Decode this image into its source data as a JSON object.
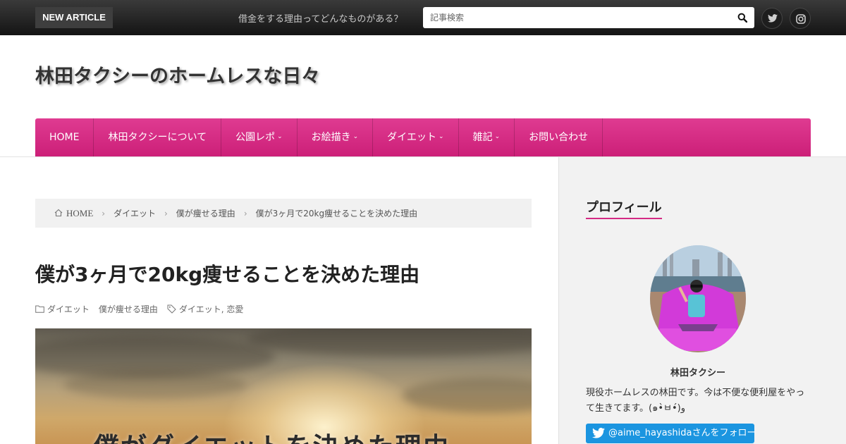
{
  "topbar": {
    "new_article_label": "NEW ARTICLE",
    "ticker_text": "借金をする理由ってどんなものがある？",
    "search_placeholder": "記事検索",
    "search_icon": "search-icon",
    "social_icons": [
      "twitter-icon",
      "instagram-icon"
    ]
  },
  "site": {
    "title": "林田タクシーのホームレスな日々"
  },
  "nav": {
    "items": [
      {
        "label": "HOME",
        "has_dropdown": false
      },
      {
        "label": "林田タクシーについて",
        "has_dropdown": false
      },
      {
        "label": "公園レポ",
        "has_dropdown": true
      },
      {
        "label": "お絵描き",
        "has_dropdown": true
      },
      {
        "label": "ダイエット",
        "has_dropdown": true
      },
      {
        "label": "雑記",
        "has_dropdown": true
      },
      {
        "label": "お問い合わせ",
        "has_dropdown": false
      }
    ],
    "color": "#d42a84"
  },
  "breadcrumb": {
    "items": [
      "HOME",
      "ダイエット",
      "僕が痩せる理由",
      "僕が3ヶ月で20kg痩せることを決めた理由"
    ]
  },
  "article": {
    "title": "僕が3ヶ月で20kg痩せることを決めた理由",
    "categories": [
      "ダイエット",
      "僕が痩せる理由"
    ],
    "tags": "ダイエット, 恋愛",
    "hero_text": "僕がダイエットを決めた理由"
  },
  "sidebar": {
    "widget_title": "プロフィール",
    "profile_name": "林田タクシー",
    "profile_desc": "現役ホームレスの林田です。今は不便な便利屋をやって生きてます。(๑•̀ㅂ•́)و",
    "follow_label": "@aime_hayashidaさんをフォロー"
  },
  "colors": {
    "accent": "#d42a84",
    "topbar": "#1f1f1f",
    "twitter_blue": "#1b95e0"
  }
}
